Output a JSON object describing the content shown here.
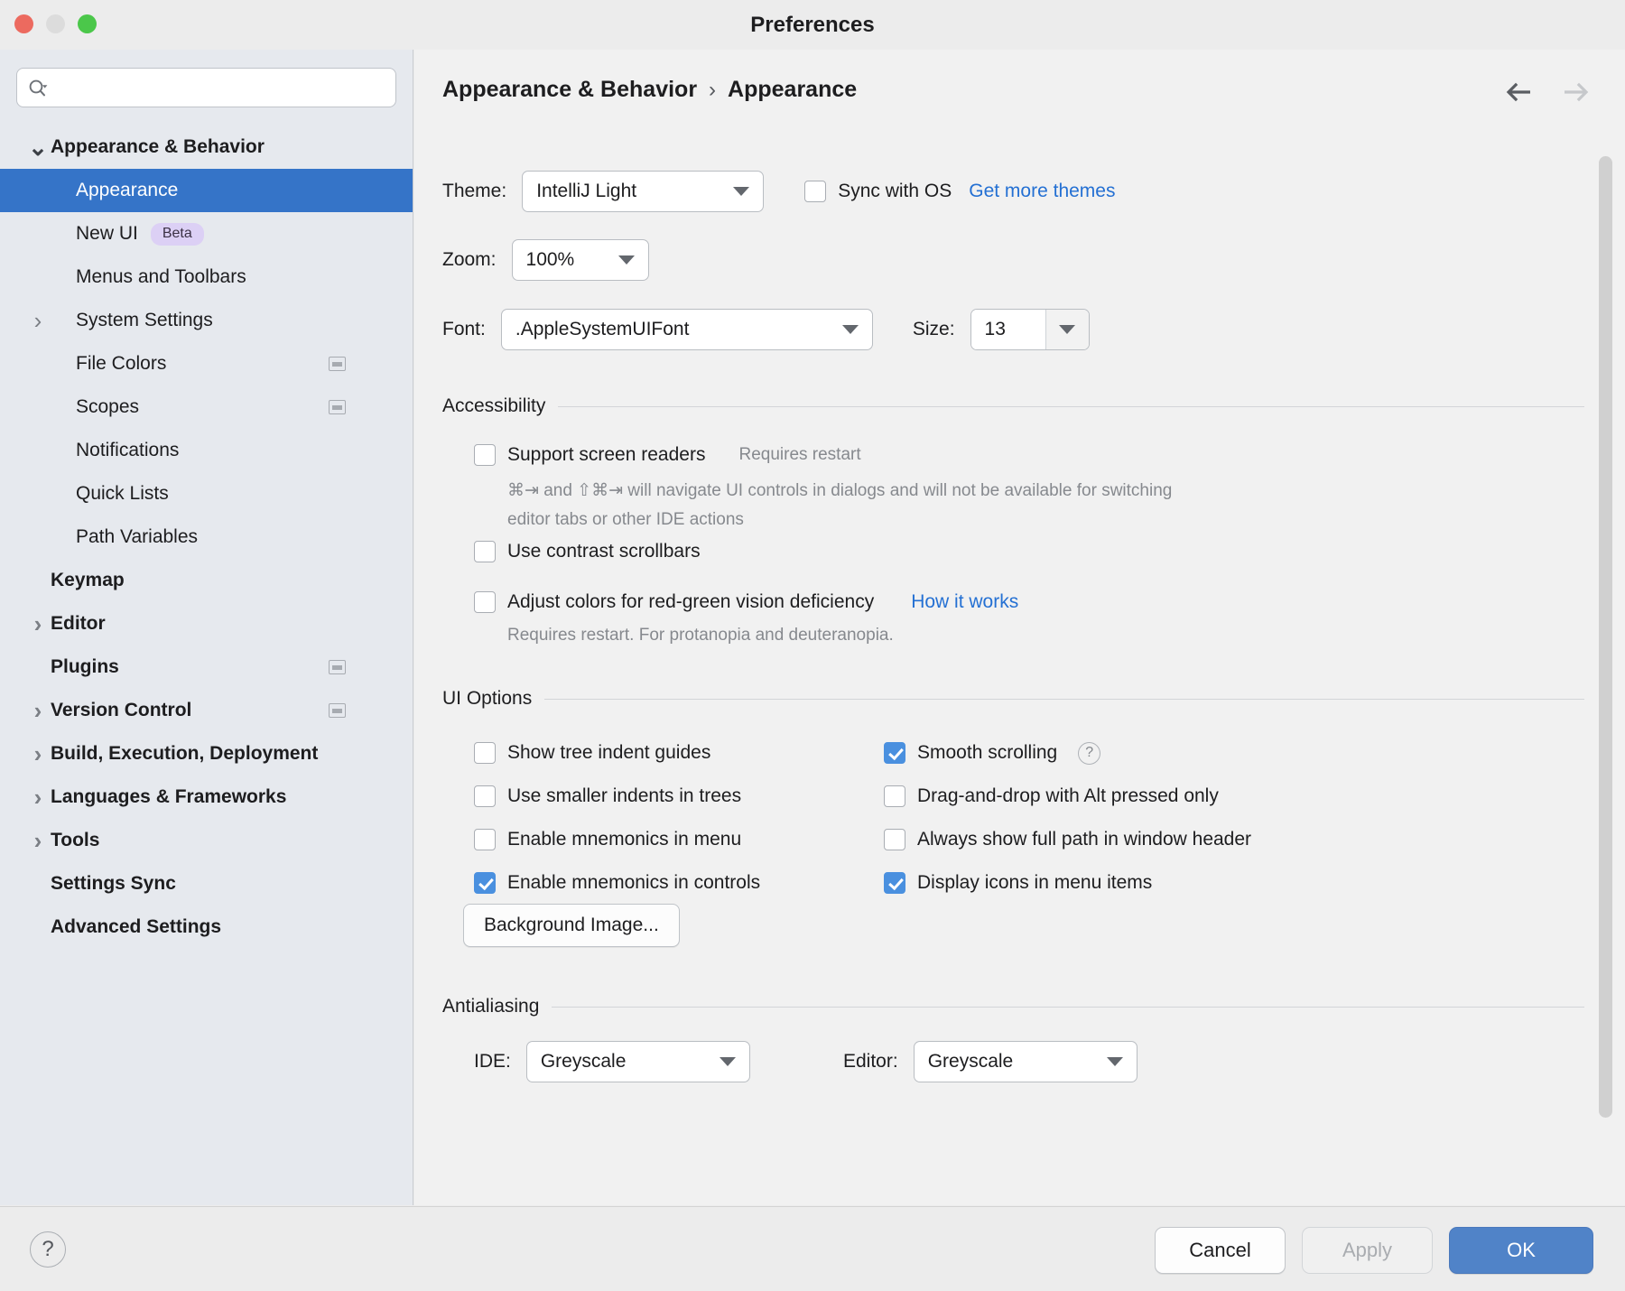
{
  "window": {
    "title": "Preferences",
    "traffic_lights": [
      "close-red",
      "minimize-grey",
      "zoom-green"
    ]
  },
  "sidebar": {
    "search": {
      "value": "",
      "placeholder": ""
    },
    "items": [
      {
        "label": "Appearance & Behavior",
        "indent": 0,
        "twisty": "down",
        "bold": true,
        "selected": false,
        "badge": null,
        "config_icon": false
      },
      {
        "label": "Appearance",
        "indent": 1,
        "twisty": "none",
        "bold": false,
        "selected": true,
        "badge": null,
        "config_icon": false
      },
      {
        "label": "New UI",
        "indent": 1,
        "twisty": "none",
        "bold": false,
        "selected": false,
        "badge": "Beta",
        "config_icon": false
      },
      {
        "label": "Menus and Toolbars",
        "indent": 1,
        "twisty": "none",
        "bold": false,
        "selected": false,
        "badge": null,
        "config_icon": false
      },
      {
        "label": "System Settings",
        "indent": 1,
        "twisty": "right",
        "bold": false,
        "selected": false,
        "badge": null,
        "config_icon": false
      },
      {
        "label": "File Colors",
        "indent": 1,
        "twisty": "none",
        "bold": false,
        "selected": false,
        "badge": null,
        "config_icon": true
      },
      {
        "label": "Scopes",
        "indent": 1,
        "twisty": "none",
        "bold": false,
        "selected": false,
        "badge": null,
        "config_icon": true
      },
      {
        "label": "Notifications",
        "indent": 1,
        "twisty": "none",
        "bold": false,
        "selected": false,
        "badge": null,
        "config_icon": false
      },
      {
        "label": "Quick Lists",
        "indent": 1,
        "twisty": "none",
        "bold": false,
        "selected": false,
        "badge": null,
        "config_icon": false
      },
      {
        "label": "Path Variables",
        "indent": 1,
        "twisty": "none",
        "bold": false,
        "selected": false,
        "badge": null,
        "config_icon": false
      },
      {
        "label": "Keymap",
        "indent": 0,
        "twisty": "none",
        "bold": true,
        "selected": false,
        "badge": null,
        "config_icon": false
      },
      {
        "label": "Editor",
        "indent": 0,
        "twisty": "right",
        "bold": true,
        "selected": false,
        "badge": null,
        "config_icon": false
      },
      {
        "label": "Plugins",
        "indent": 0,
        "twisty": "none",
        "bold": true,
        "selected": false,
        "badge": null,
        "config_icon": true
      },
      {
        "label": "Version Control",
        "indent": 0,
        "twisty": "right",
        "bold": true,
        "selected": false,
        "badge": null,
        "config_icon": true
      },
      {
        "label": "Build, Execution, Deployment",
        "indent": 0,
        "twisty": "right",
        "bold": true,
        "selected": false,
        "badge": null,
        "config_icon": false
      },
      {
        "label": "Languages & Frameworks",
        "indent": 0,
        "twisty": "right",
        "bold": true,
        "selected": false,
        "badge": null,
        "config_icon": false
      },
      {
        "label": "Tools",
        "indent": 0,
        "twisty": "right",
        "bold": true,
        "selected": false,
        "badge": null,
        "config_icon": false
      },
      {
        "label": "Settings Sync",
        "indent": 0,
        "twisty": "none",
        "bold": true,
        "selected": false,
        "badge": null,
        "config_icon": false
      },
      {
        "label": "Advanced Settings",
        "indent": 0,
        "twisty": "none",
        "bold": true,
        "selected": false,
        "badge": null,
        "config_icon": false
      }
    ]
  },
  "content": {
    "breadcrumb": {
      "parent": "Appearance & Behavior",
      "separator": "›",
      "current": "Appearance"
    },
    "nav": {
      "back": "back-arrow",
      "forward": "forward-arrow",
      "back_enabled": true,
      "forward_enabled": false
    },
    "theme_row": {
      "label": "Theme:",
      "value": "IntelliJ Light",
      "sync_label": "Sync with OS",
      "sync_checked": false,
      "more_themes_link": "Get more themes"
    },
    "zoom_row": {
      "label": "Zoom:",
      "value": "100%"
    },
    "font_row": {
      "label": "Font:",
      "value": ".AppleSystemUIFont",
      "size_label": "Size:",
      "size_value": "13"
    },
    "accessibility": {
      "title": "Accessibility",
      "screen_readers": {
        "label": "Support screen readers",
        "checked": false,
        "hint": "Requires restart",
        "description_line1": "⌘⇥ and ⇧⌘⇥ will navigate UI controls in dialogs and will not be available for switching",
        "description_line2": "editor tabs or other IDE actions"
      },
      "contrast_scrollbars": {
        "label": "Use contrast scrollbars",
        "checked": false
      },
      "red_green": {
        "label": "Adjust colors for red-green vision deficiency",
        "checked": false,
        "link": "How it works",
        "description": "Requires restart. For protanopia and deuteranopia."
      }
    },
    "ui_options": {
      "title": "UI Options",
      "left_column": [
        {
          "label": "Show tree indent guides",
          "checked": false
        },
        {
          "label": "Use smaller indents in trees",
          "checked": false
        },
        {
          "label": "Enable mnemonics in menu",
          "checked": false
        },
        {
          "label": "Enable mnemonics in controls",
          "checked": true
        }
      ],
      "right_column": [
        {
          "label": "Smooth scrolling",
          "checked": true,
          "help": "?"
        },
        {
          "label": "Drag-and-drop with Alt pressed only",
          "checked": false,
          "help": null
        },
        {
          "label": "Always show full path in window header",
          "checked": false,
          "help": null
        },
        {
          "label": "Display icons in menu items",
          "checked": true,
          "help": null
        }
      ],
      "background_image_button": "Background Image..."
    },
    "antialiasing": {
      "title": "Antialiasing",
      "ide": {
        "label": "IDE:",
        "value": "Greyscale"
      },
      "editor": {
        "label": "Editor:",
        "value": "Greyscale"
      }
    }
  },
  "footer": {
    "help": "?",
    "cancel": "Cancel",
    "apply": "Apply",
    "ok": "OK",
    "apply_enabled": false
  },
  "colors": {
    "accent_blue": "#3574C8",
    "checkbox_blue": "#4A90DF",
    "link_blue": "#2470D3",
    "ok_button": "#5083C8",
    "sidebar_bg": "#E6E9EE",
    "content_bg": "#F1F1F1",
    "chrome_bg": "#ECECEC",
    "beta_badge": "#DCD0F5"
  }
}
